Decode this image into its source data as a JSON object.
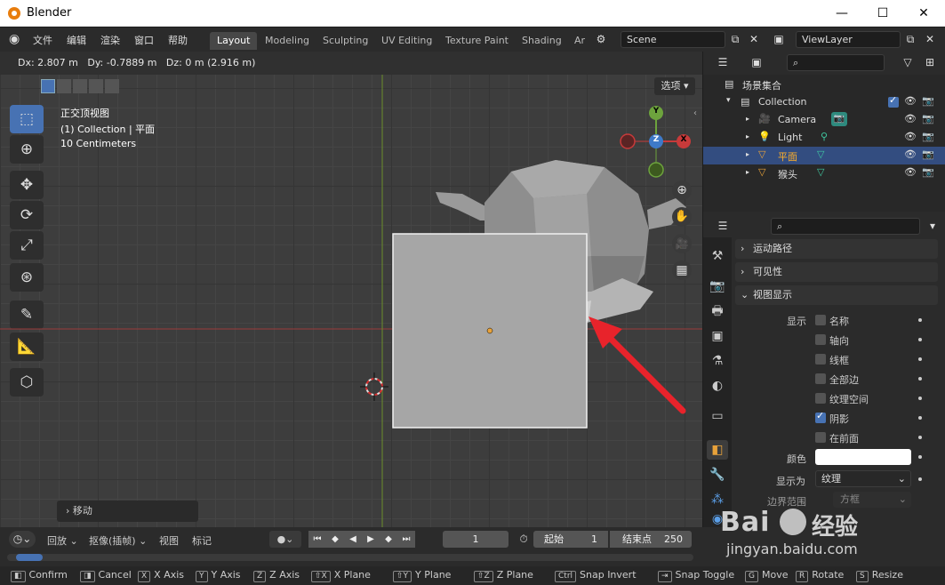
{
  "window": {
    "title": "Blender",
    "minimize": "—",
    "maximize": "☐",
    "close": "✕"
  },
  "menu": [
    "文件",
    "编辑",
    "渲染",
    "窗口",
    "帮助"
  ],
  "workspaces": [
    "Layout",
    "Modeling",
    "Sculpting",
    "UV Editing",
    "Texture Paint",
    "Shading",
    "Ar"
  ],
  "scene": "Scene",
  "view_layer": "ViewLayer",
  "viewport": {
    "transform_info": "Dx: 2.807 m   Dy: -0.7889 m   Dz: 0 m (2.916 m)",
    "options_btn": "选项",
    "view_name": "正交顶视图",
    "collection_info": "(1) Collection | 平面",
    "scale_info": "10 Centimeters",
    "operator_panel": "移动",
    "axis_labels": {
      "x": "X",
      "y": "Y",
      "z": "Z"
    }
  },
  "outliner": {
    "root": "场景集合",
    "collection": "Collection",
    "items": [
      {
        "name": "Camera"
      },
      {
        "name": "Light"
      },
      {
        "name": "平面"
      },
      {
        "name": "猴头"
      }
    ]
  },
  "properties": {
    "sections": {
      "motion_path": "运动路径",
      "visibility": "可见性",
      "viewport_display": "视图显示"
    },
    "display_label": "显示",
    "options": [
      {
        "label": "名称",
        "checked": false
      },
      {
        "label": "轴向",
        "checked": false
      },
      {
        "label": "线框",
        "checked": false
      },
      {
        "label": "全部边",
        "checked": false
      },
      {
        "label": "纹理空间",
        "checked": false
      },
      {
        "label": "阴影",
        "checked": true
      },
      {
        "label": "在前面",
        "checked": false
      }
    ],
    "color_label": "颜色",
    "display_as_label": "显示为",
    "display_as_value": "纹理",
    "bounds_label": "边界范围",
    "bounds_value": "方框"
  },
  "timeline": {
    "playback": "回放",
    "keying": "抠像(插帧)",
    "view": "视图",
    "marker": "标记",
    "current_frame": "1",
    "start_label": "起始",
    "start": "1",
    "end_label": "结束点",
    "end": "250"
  },
  "statusbar": [
    {
      "key": "",
      "label": "Confirm"
    },
    {
      "key": "",
      "label": "Cancel"
    },
    {
      "key": "X",
      "label": "X Axis"
    },
    {
      "key": "Y",
      "label": "Y Axis"
    },
    {
      "key": "Z",
      "label": "Z Axis"
    },
    {
      "key": "⇧X",
      "label": "X Plane"
    },
    {
      "key": "⇧Y",
      "label": "Y Plane"
    },
    {
      "key": "⇧Z",
      "label": "Z Plane"
    },
    {
      "key": "Ctrl",
      "label": "Snap Invert"
    },
    {
      "key": "",
      "label": "Snap Toggle"
    },
    {
      "key": "G",
      "label": "Move"
    },
    {
      "key": "R",
      "label": "Rotate"
    },
    {
      "key": "S",
      "label": "Resize"
    }
  ],
  "watermark": {
    "brand": "Bai",
    "brand2": "经验",
    "url": "jingyan.baidu.com"
  },
  "colors": {
    "accent": "#4772b3",
    "selected_row": "#334d80",
    "arrow": "#e8232b",
    "x_axis": "#c83a3a",
    "y_axis": "#6da33d"
  }
}
